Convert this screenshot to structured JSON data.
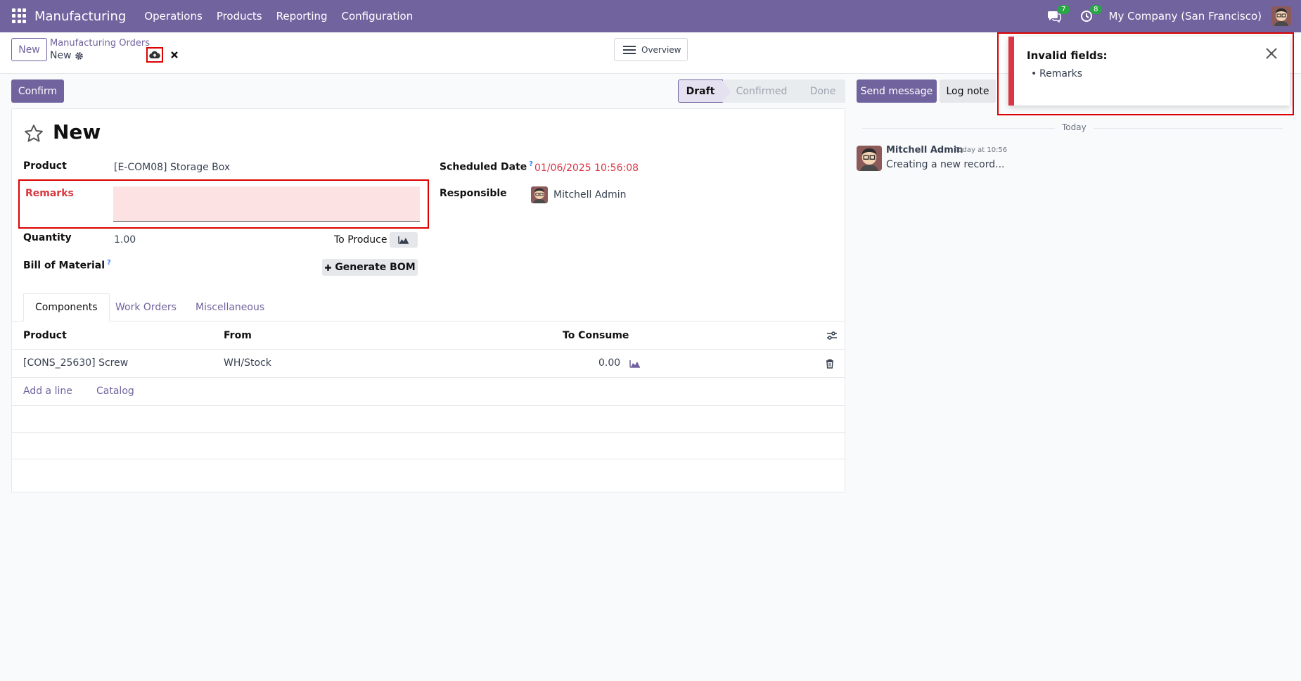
{
  "navbar": {
    "app_name": "Manufacturing",
    "menu": [
      "Operations",
      "Products",
      "Reporting",
      "Configuration"
    ],
    "messages_badge": "7",
    "activities_badge": "8",
    "company": "My Company (San Francisco)"
  },
  "control_panel": {
    "new_label": "New",
    "breadcrumb_parent": "Manufacturing Orders",
    "breadcrumb_current": "New",
    "overview_label": "Overview"
  },
  "actions": {
    "confirm_label": "Confirm",
    "status_steps": [
      "Draft",
      "Confirmed",
      "Done"
    ],
    "active_status": "Draft",
    "send_message_label": "Send message",
    "log_note_label": "Log note"
  },
  "form": {
    "title": "New",
    "product_label": "Product",
    "product_value": "[E-COM08] Storage Box",
    "remarks_label": "Remarks",
    "remarks_value": "",
    "quantity_label": "Quantity",
    "quantity_value": "1.00",
    "to_produce_label": "To Produce",
    "bom_label": "Bill of Material",
    "generate_bom_label": "Generate BOM",
    "scheduled_date_label": "Scheduled Date",
    "scheduled_date_value": "01/06/2025 10:56:08",
    "responsible_label": "Responsible",
    "responsible_value": "Mitchell Admin",
    "help_mark": "?"
  },
  "tabs": [
    "Components",
    "Work Orders",
    "Miscellaneous"
  ],
  "components_table": {
    "headers": [
      "Product",
      "From",
      "To Consume"
    ],
    "rows": [
      {
        "product": "[CONS_25630] Screw",
        "from": "WH/Stock",
        "to_consume": "0.00"
      }
    ],
    "add_line_label": "Add a line",
    "catalog_label": "Catalog"
  },
  "chatter": {
    "date_separator": "Today",
    "message": {
      "author": "Mitchell Admin",
      "time": "Today at 10:56",
      "body": "Creating a new record..."
    }
  },
  "notification": {
    "title": "Invalid fields:",
    "items": [
      "Remarks"
    ]
  },
  "colors": {
    "brand": "#71639e",
    "danger": "#dc3545",
    "invalid_bg": "#fde2e4"
  }
}
